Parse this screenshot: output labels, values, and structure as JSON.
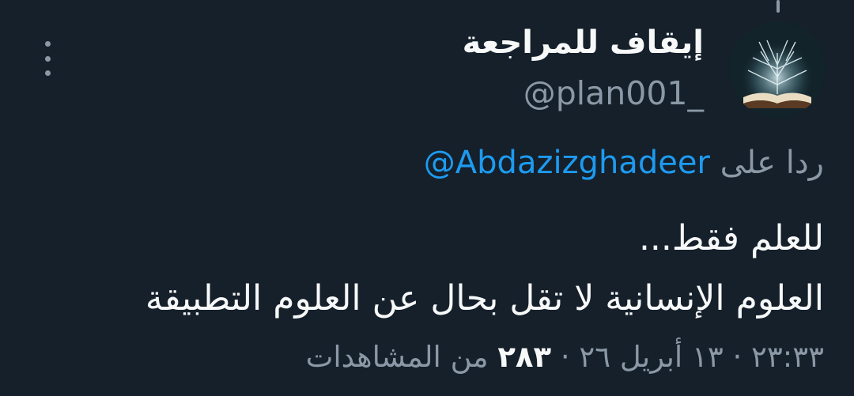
{
  "tweet": {
    "author": {
      "display_name": "إيقاف للمراجعة",
      "handle": "@plan001_",
      "avatar_icon": "book-tree-avatar"
    },
    "reply": {
      "label": "ردا على",
      "target": "@Abdazizghadeer"
    },
    "text_lines": [
      "للعلم فقط...",
      "العلوم الإنسانية لا تقل بحال عن العلوم التطبيقة"
    ],
    "meta": {
      "time": "٢٣:٣٣",
      "separator": "·",
      "date": "١٣ أبريل ٢٦",
      "views_count": "٢٨٣",
      "views_label": "من المشاهدات"
    },
    "more_icon": "more-vertical-icon"
  },
  "colors": {
    "background": "#15202b",
    "primary_text": "#f7f9f9",
    "secondary_text": "#8b98a5",
    "link": "#1d9bf0"
  }
}
